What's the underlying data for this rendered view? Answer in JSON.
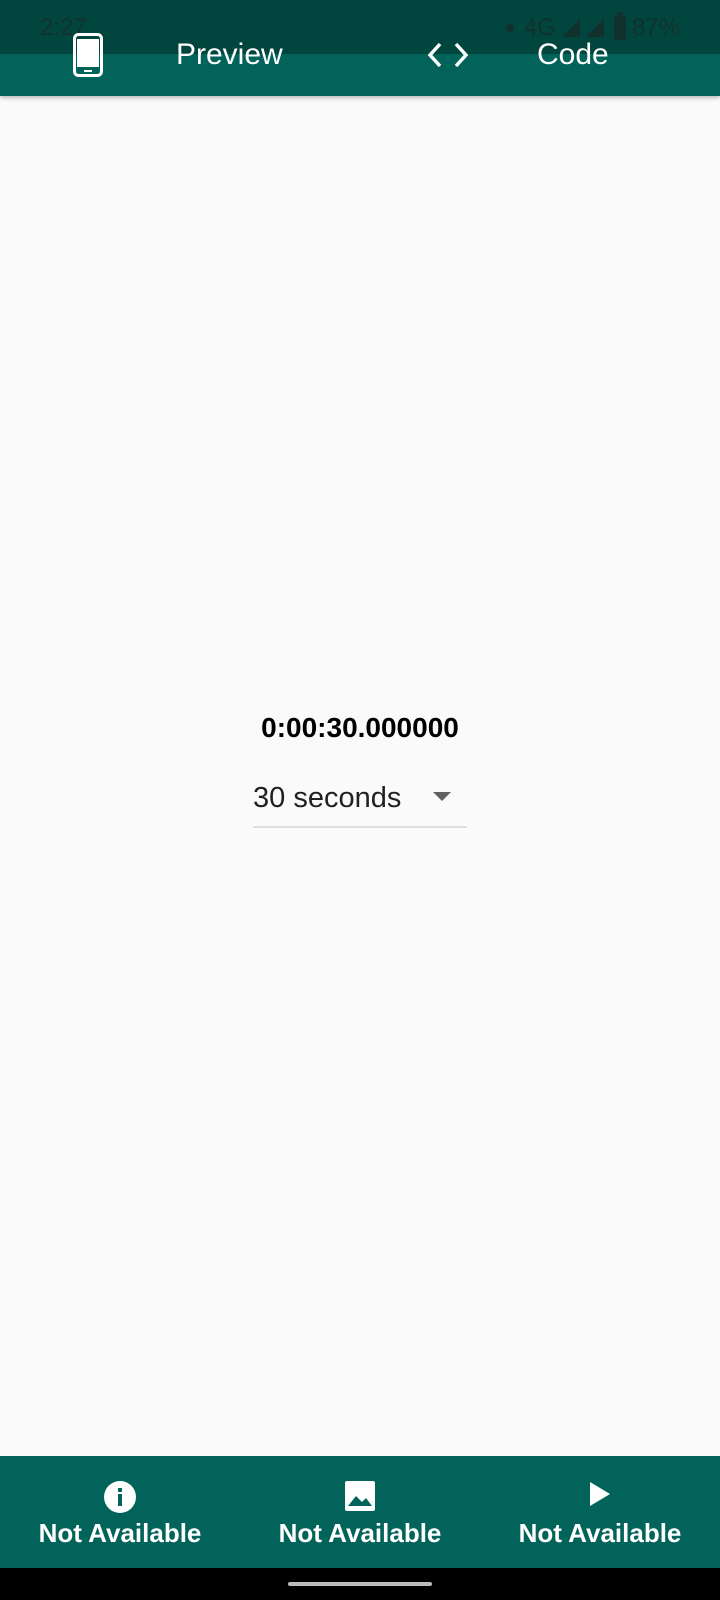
{
  "status_bar": {
    "time": "2:27",
    "network": "4G",
    "battery": "87%"
  },
  "tabs": {
    "preview_label": "Preview",
    "code_label": "Code"
  },
  "main": {
    "duration_text": "0:00:30.000000",
    "dropdown_value": "30 seconds"
  },
  "bottom_nav": [
    {
      "icon": "info-icon",
      "label": "Not Available"
    },
    {
      "icon": "image-icon",
      "label": "Not Available"
    },
    {
      "icon": "play-icon",
      "label": "Not Available"
    }
  ],
  "colors": {
    "primary": "#02635a",
    "status_bar": "#00463f",
    "background": "#fafafa"
  }
}
